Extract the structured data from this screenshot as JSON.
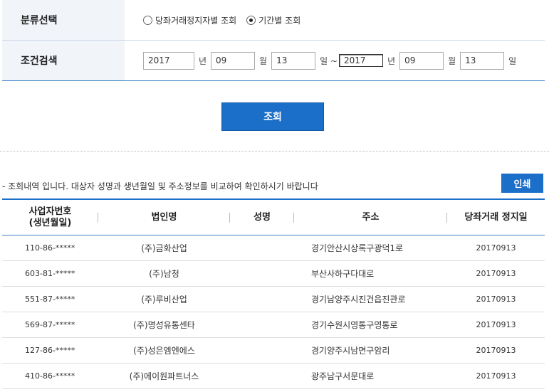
{
  "filter": {
    "category_label": "분류선택",
    "category_options": [
      {
        "label": "당좌거래정지자별 조회",
        "checked": false
      },
      {
        "label": "기간별 조회",
        "checked": true
      }
    ],
    "search_label": "조건검색",
    "start": {
      "year": "2017",
      "month": "09",
      "day": "13"
    },
    "end": {
      "year": "2017",
      "month": "09",
      "day": "13"
    },
    "units": {
      "year": "년",
      "month": "월",
      "day": "일",
      "range": "일 ~"
    }
  },
  "search_button": "조회",
  "notice": "- 조회내역 입니다. 대상자 성명과 생년월일 및 주소정보를 비교하여 확인하시기 바랍니다",
  "print_button": "인쇄",
  "table": {
    "headers": {
      "biz_no": "사업자번호",
      "biz_no_sub": "(생년월일)",
      "corp": "법인명",
      "name": "성명",
      "address": "주소",
      "date": "당좌거래 정지일"
    },
    "rows": [
      {
        "biz_no": "110-86-*****",
        "corp": "(주)금화산업",
        "name": "",
        "address": "경기안산시상록구광덕1로",
        "date": "20170913"
      },
      {
        "biz_no": "603-81-*****",
        "corp": "(주)남청",
        "name": "",
        "address": "부산사하구다대로",
        "date": "20170913"
      },
      {
        "biz_no": "551-87-*****",
        "corp": "(주)루비산업",
        "name": "",
        "address": "경기남양주시진건읍진관로",
        "date": "20170913"
      },
      {
        "biz_no": "569-87-*****",
        "corp": "(주)명성유통센타",
        "name": "",
        "address": "경기수원시영통구영통로",
        "date": "20170913"
      },
      {
        "biz_no": "127-86-*****",
        "corp": "(주)성은엠엔에스",
        "name": "",
        "address": "경기양주시남면구암리",
        "date": "20170913"
      },
      {
        "biz_no": "410-86-*****",
        "corp": "(주)에이원파트너스",
        "name": "",
        "address": "광주남구서문대로",
        "date": "20170913"
      }
    ]
  }
}
